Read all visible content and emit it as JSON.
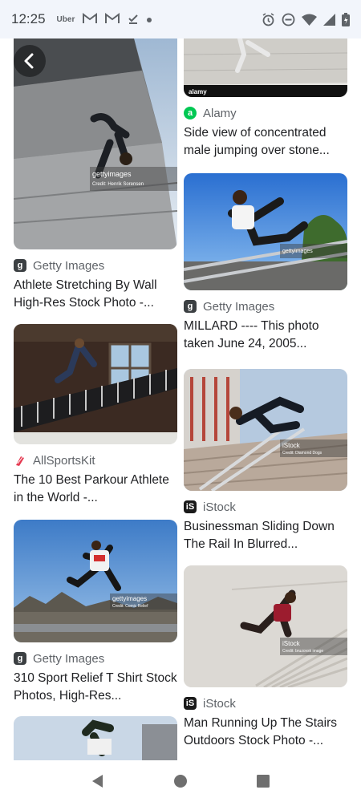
{
  "status_bar": {
    "time": "12:25",
    "left_icons": [
      "uber-icon",
      "gmail-icon",
      "gmail-icon",
      "check-icon",
      "dot-icon"
    ],
    "uber_text": "Uber",
    "right_icons": [
      "alarm-icon",
      "dnd-icon",
      "wifi-icon",
      "signal-icon",
      "battery-icon"
    ]
  },
  "results": {
    "left": [
      {
        "source": "Getty Images",
        "source_icon": "getty-icon",
        "title": "Athlete Stretching By Wall High-Res Stock Photo -..."
      },
      {
        "source": "AllSportsKit",
        "source_icon": "allsportskit-icon",
        "title": "The 10 Best Parkour Athlete in the World -..."
      },
      {
        "source": "Getty Images",
        "source_icon": "getty-icon",
        "title": "310 Sport Relief T Shirt Stock Photos, High-Res..."
      }
    ],
    "right": [
      {
        "source": "Alamy",
        "source_icon": "alamy-icon",
        "title": "Side view of concentrated male jumping over stone..."
      },
      {
        "source": "Getty Images",
        "source_icon": "getty-icon",
        "title": "MILLARD ---- This photo taken June 24, 2005..."
      },
      {
        "source": "iStock",
        "source_icon": "istock-icon",
        "title": "Businessman Sliding Down The Rail In Blurred..."
      },
      {
        "source": "iStock",
        "source_icon": "istock-icon",
        "title": "Man Running Up The Stairs Outdoors Stock Photo -..."
      }
    ]
  },
  "watermarks": {
    "getty": "gettyimages",
    "getty_credit_1": "Credit: Henrik Sorensen",
    "getty_credit_2": "Credit: Comic Relief",
    "istock": "iStock",
    "istock_credit_1": "Credit: Diamond Dogs",
    "istock_credit_2": "Credit: bruzovsk image",
    "alamy": "alamy"
  },
  "colors": {
    "status_bar_bg": "#f2f5fb",
    "alamy_green": "#00c853",
    "allsportskit_red": "#e53950",
    "getty_dark": "#3c4043"
  },
  "nav": {
    "buttons": [
      "back-triangle-icon",
      "home-circle-icon",
      "recents-square-icon"
    ]
  }
}
